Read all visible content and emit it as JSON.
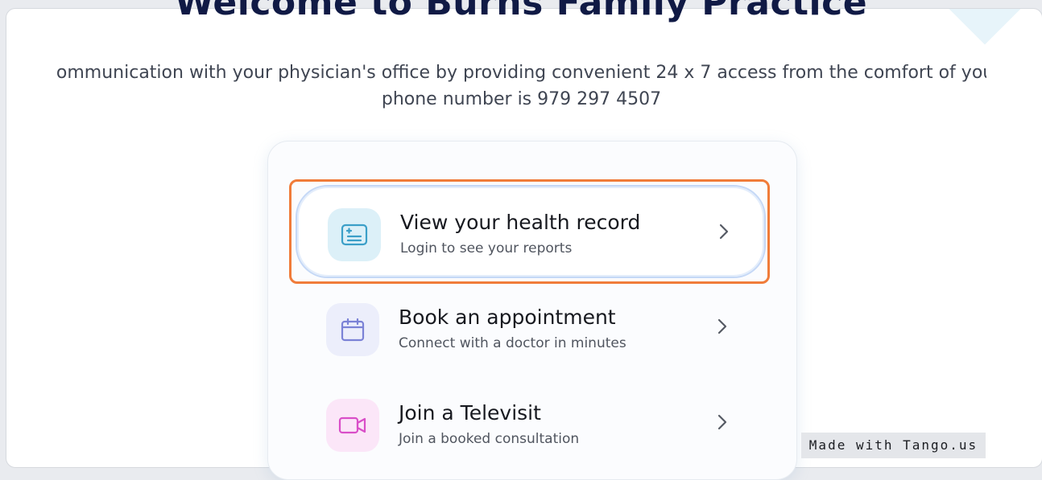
{
  "page": {
    "title": "Welcome to Burns Family Practice",
    "subtitle_line1": "Better communication with your physician's office by providing convenient 24 x 7 access from the comfort of your home",
    "subtitle_line2": "phone number is 979 297 4507"
  },
  "options": [
    {
      "title": "View your health record",
      "description": "Login to see your reports",
      "icon": "health-record-icon",
      "icon_bg": "#dcf0f8",
      "icon_color": "#3b9fc8",
      "highlighted": true
    },
    {
      "title": "Book an appointment",
      "description": "Connect with a doctor in minutes",
      "icon": "calendar-icon",
      "icon_bg": "#eceefb",
      "icon_color": "#7b82d6",
      "highlighted": false
    },
    {
      "title": "Join a Televisit",
      "description": "Join a booked consultation",
      "icon": "video-camera-icon",
      "icon_bg": "#fbe6f8",
      "icon_color": "#d94fc8",
      "highlighted": false
    }
  ],
  "badge": {
    "text": "Made with Tango.us"
  },
  "colors": {
    "heading": "#101a45",
    "highlight_border": "#f07c3a",
    "active_border": "#c5d8f6"
  }
}
